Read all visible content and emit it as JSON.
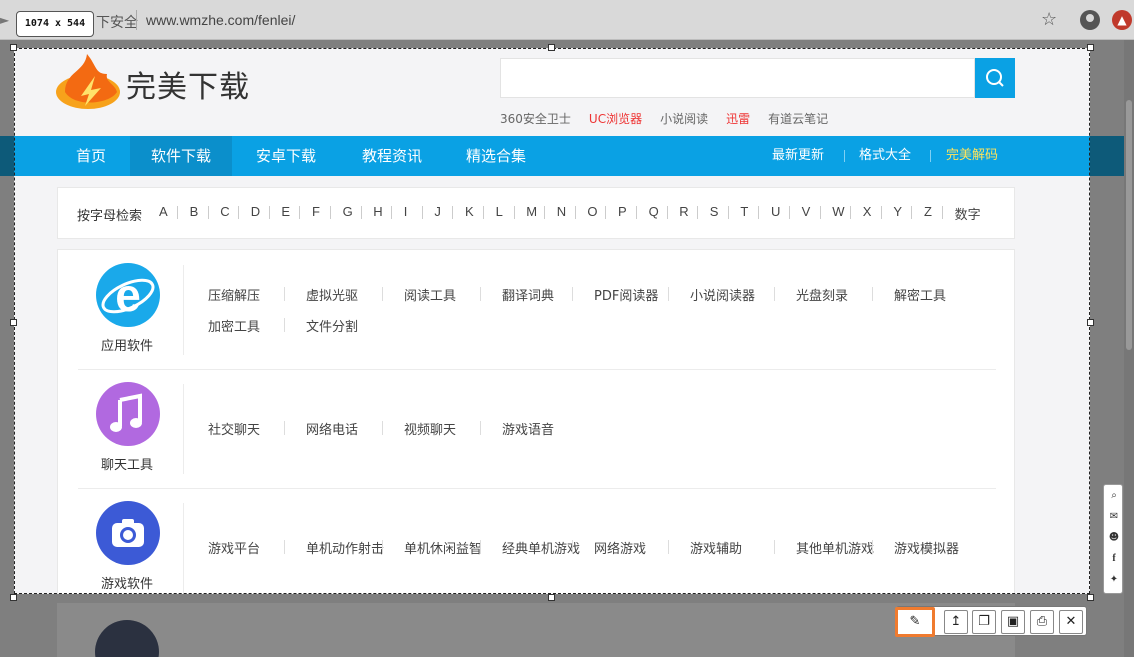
{
  "browser": {
    "address_prefix": "下安全",
    "url": "www.wmzhe.com/fenlei/"
  },
  "capture": {
    "dimensions": "1074 x 544"
  },
  "site": {
    "logo_text": "完美下载",
    "search_placeholder": "",
    "hotlinks": [
      {
        "label": "360安全卫士",
        "color": "#666666"
      },
      {
        "label": "UC浏览器",
        "color": "#ee3333"
      },
      {
        "label": "小说阅读",
        "color": "#666666"
      },
      {
        "label": "迅雷",
        "color": "#ee3333"
      },
      {
        "label": "有道云笔记",
        "color": "#666666"
      }
    ],
    "nav": [
      "首页",
      "软件下载",
      "安卓下载",
      "教程资讯",
      "精选合集"
    ],
    "nav_active_index": 1,
    "nav_right": [
      "最新更新",
      "格式大全",
      "完美解码"
    ],
    "alpha_label": "按字母检索",
    "letters": [
      "A",
      "B",
      "C",
      "D",
      "E",
      "F",
      "G",
      "H",
      "I",
      "J",
      "K",
      "L",
      "M",
      "N",
      "O",
      "P",
      "Q",
      "R",
      "S",
      "T",
      "U",
      "V",
      "W",
      "X",
      "Y",
      "Z",
      "数字"
    ],
    "categories": [
      {
        "name": "应用软件",
        "icon": "ie-icon",
        "color": "#1aa9ea",
        "subs": [
          "压缩解压",
          "虚拟光驱",
          "阅读工具",
          "翻译词典",
          "PDF阅读器",
          "小说阅读器",
          "光盘刻录",
          "解密工具",
          "加密工具",
          "文件分割"
        ]
      },
      {
        "name": "聊天工具",
        "icon": "music-icon",
        "color": "#b169e0",
        "subs": [
          "社交聊天",
          "网络电话",
          "视频聊天",
          "游戏语音"
        ]
      },
      {
        "name": "游戏软件",
        "icon": "camera-icon",
        "color": "#3c5ad6",
        "subs": [
          "游戏平台",
          "单机动作射击",
          "单机休闲益智",
          "经典单机游戏",
          "网络游戏",
          "游戏辅助",
          "其他单机游戏",
          "游戏模拟器"
        ]
      }
    ]
  },
  "share_icons": [
    "search-icon",
    "mail-icon",
    "reddit-icon",
    "facebook-icon",
    "twitter-icon"
  ],
  "toolbar": [
    "pencil-icon",
    "upload-icon",
    "copy-icon",
    "save-icon",
    "print-icon",
    "close-icon"
  ]
}
